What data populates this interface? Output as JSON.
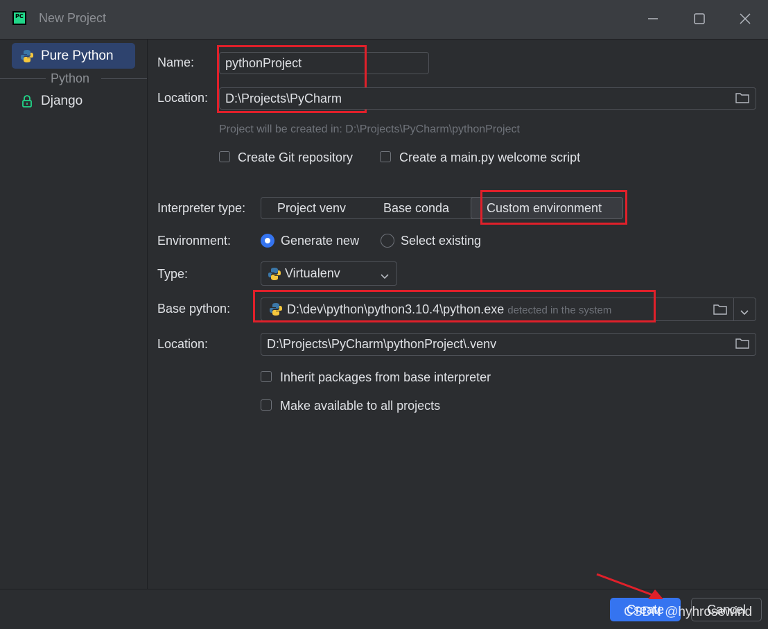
{
  "window": {
    "title": "New Project",
    "logo_text": "PC",
    "minimize_icon": "minimize-icon",
    "maximize_icon": "maximize-icon",
    "close_icon": "close-icon"
  },
  "sidebar": {
    "items": [
      {
        "label": "Pure Python",
        "icon": "python-icon",
        "selected": true
      },
      {
        "label": "Django",
        "icon": "lock-icon",
        "selected": false
      }
    ],
    "group_label": "Python"
  },
  "form": {
    "name_label": "Name:",
    "name_value": "pythonProject",
    "location_label": "Location:",
    "location_value": "D:\\Projects\\PyCharm",
    "project_path_hint": "Project will be created in: D:\\Projects\\PyCharm\\pythonProject",
    "create_git_label": "Create Git repository",
    "create_git_checked": false,
    "create_main_label": "Create a main.py welcome script",
    "create_main_checked": false,
    "interpreter_type_label": "Interpreter type:",
    "interpreter_types": [
      "Project venv",
      "Base conda",
      "Custom environment"
    ],
    "interpreter_type_selected": "Custom environment",
    "environment_label": "Environment:",
    "environment_options": [
      "Generate new",
      "Select existing"
    ],
    "environment_selected": "Generate new",
    "type_label": "Type:",
    "type_value": "Virtualenv",
    "base_python_label": "Base python:",
    "base_python_value": "D:\\dev\\python\\python3.10.4\\python.exe",
    "base_python_hint": "detected in the system",
    "venv_location_label": "Location:",
    "venv_location_value": "D:\\Projects\\PyCharm\\pythonProject\\.venv",
    "inherit_label": "Inherit packages from base interpreter",
    "inherit_checked": false,
    "available_all_label": "Make available to all projects",
    "available_all_checked": false
  },
  "footer": {
    "create_label": "Create",
    "cancel_label": "Cancel"
  },
  "watermark": "CSDN @hyhrosewind",
  "colors": {
    "accent": "#3574f0",
    "annotation_red": "#e0202a",
    "background": "#2b2d30"
  }
}
